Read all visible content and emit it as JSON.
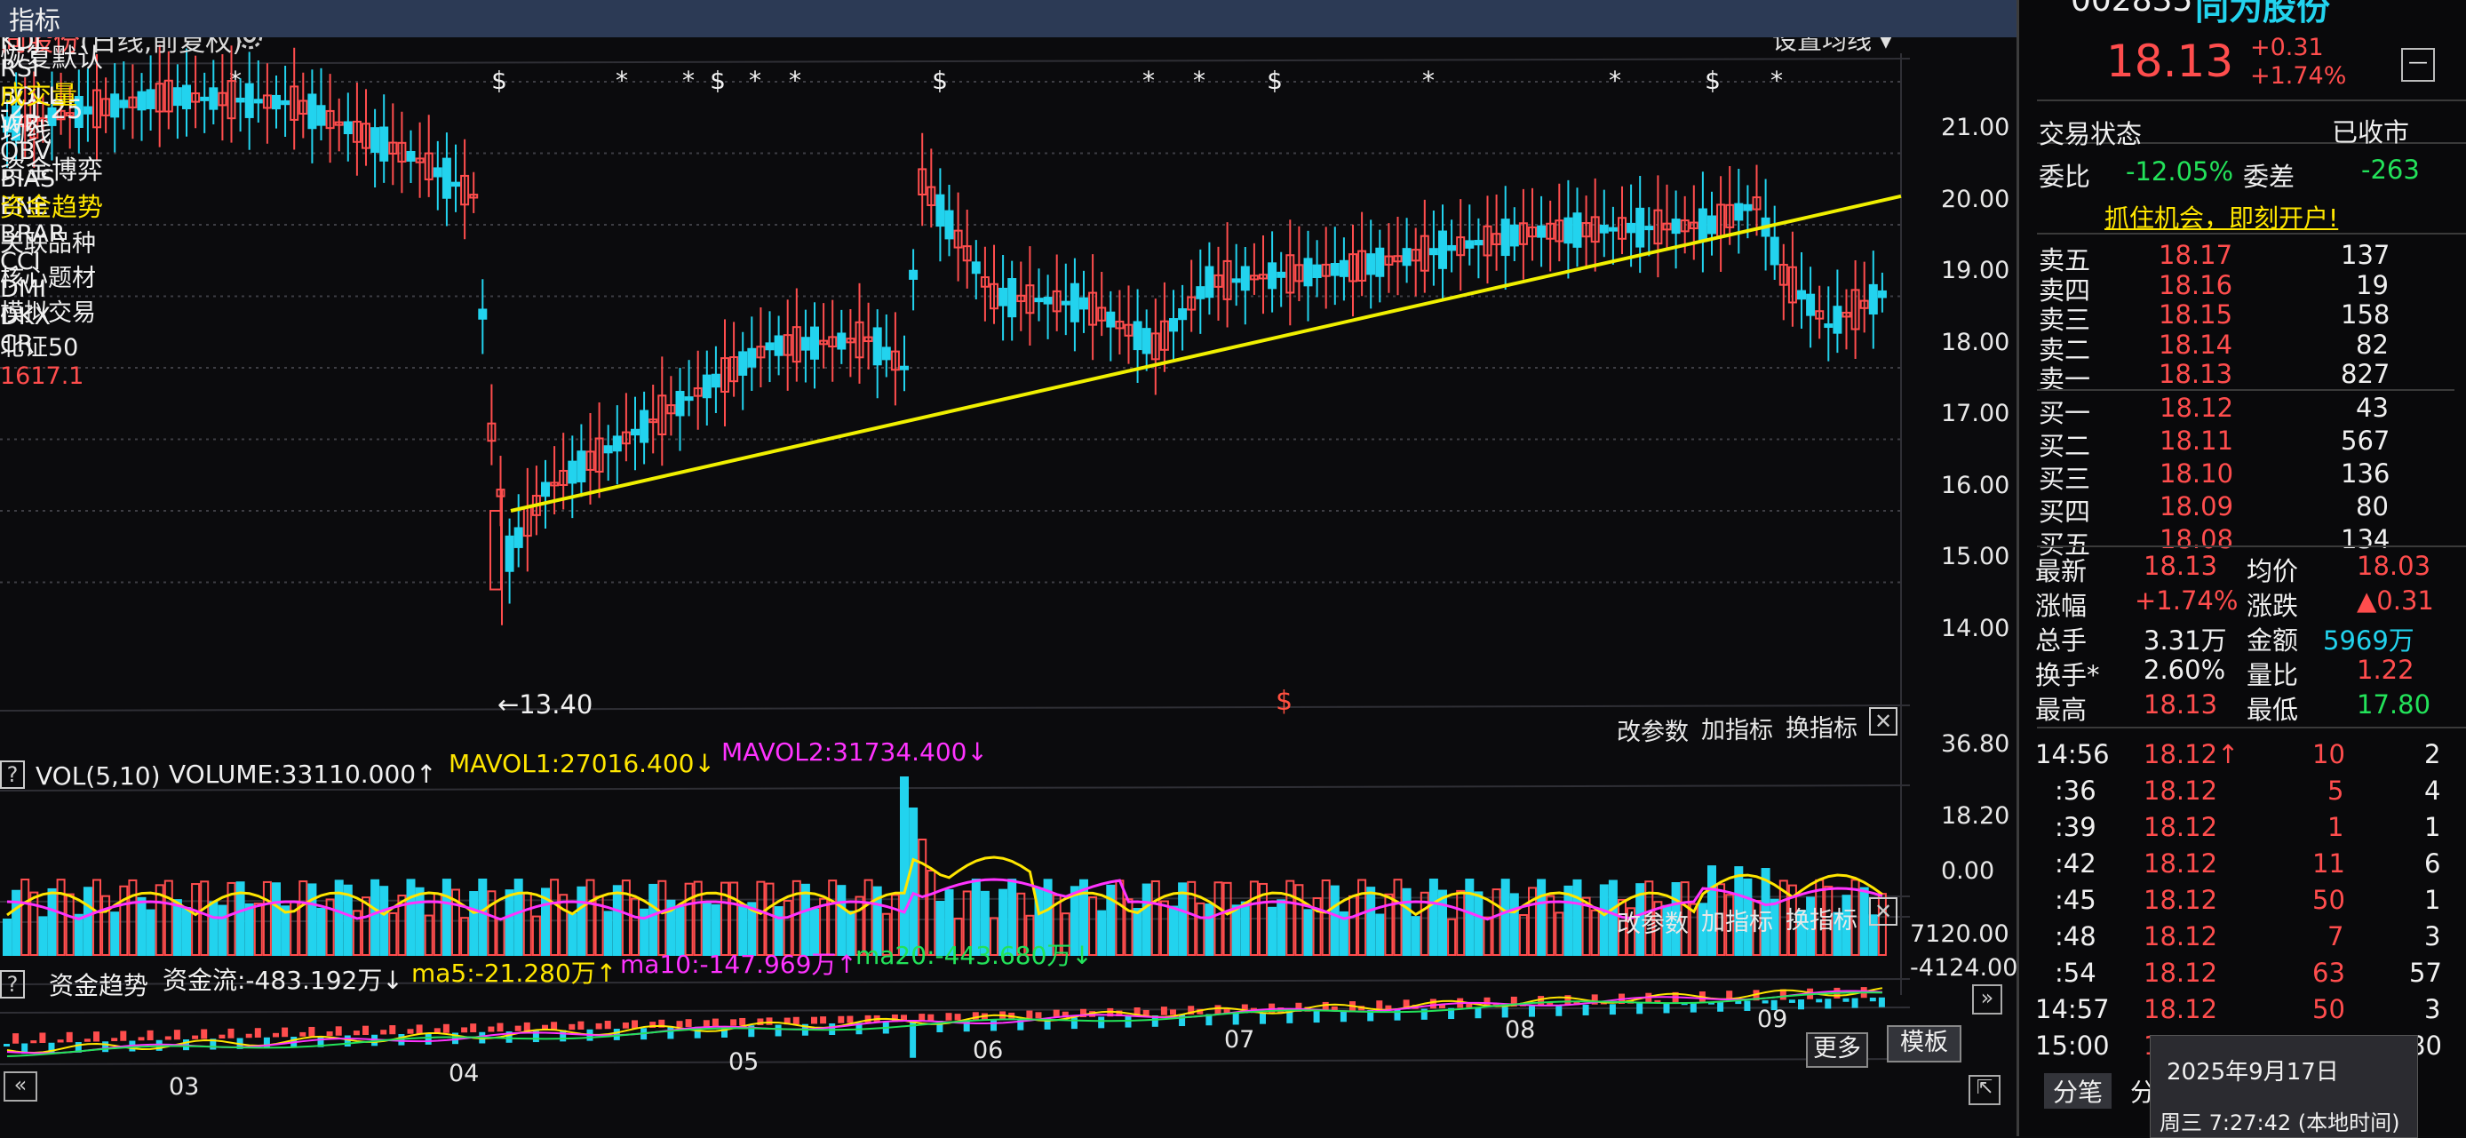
{
  "top_tabs": [
    {
      "label": "",
      "active": false
    },
    {
      "label": "",
      "active": false
    },
    {
      "label": "",
      "active": false
    },
    {
      "label": "",
      "active": false
    },
    {
      "label": "",
      "active": false
    },
    {
      "label": "",
      "active": true
    },
    {
      "label": "",
      "active": false
    },
    {
      "label": "",
      "active": false
    },
    {
      "label": "",
      "active": false
    }
  ],
  "chart": {
    "title_stock": "向股份",
    "title_mode": "(日线,前复权)",
    "set_ma_label": "设置均线 ▾",
    "price_axis": [
      "21.00",
      "20.00",
      "19.00",
      "18.00",
      "17.00",
      "16.00",
      "15.00",
      "14.00"
    ],
    "high_label": "-21.25",
    "low_label": "←13.40",
    "event_marker": "$",
    "param_btn": "改参数",
    "add_ind_btn": "加指标",
    "switch_ind_btn": "换指标",
    "close_btn": "✕"
  },
  "volume_panel": {
    "help": "?",
    "name": "VOL(5,10)",
    "volume": "VOLUME:33110.000↑",
    "mavol1": "MAVOL1:27016.400↓",
    "mavol2": "MAVOL2:31734.400↓",
    "axis": [
      "36.80",
      "18.20",
      "0.00"
    ]
  },
  "fund_panel": {
    "help": "?",
    "name": "资金趋势",
    "flow": "资金流:-483.192万↓",
    "ma5": "ma5:-21.280万↑",
    "ma10": "ma10:-147.969万↑",
    "ma20": "ma20:-443.680万↓",
    "axis": [
      "7120.00",
      "-4124.00"
    ]
  },
  "months": [
    "03",
    "04",
    "05",
    "06",
    "07",
    "08",
    "09"
  ],
  "indicator_tabs": [
    "MACD",
    "KDJ",
    "RSI",
    "BOLL",
    "WR",
    "OBV",
    "BIAS",
    "ENE",
    "BRAR",
    "CCI",
    "DMI",
    "DKX",
    "CR"
  ],
  "more_btn": "更多",
  "template_btn": "模板",
  "bottom_tabs": [
    "指标",
    "恢复默认",
    "成交量",
    "均线",
    "资金博弈",
    "资金趋势"
  ],
  "bottom_row2": [
    "关联品种",
    "核心题材",
    "模拟交易"
  ],
  "quote": {
    "code": "002835",
    "name": "同为股份",
    "price": "18.13",
    "change": "+0.31",
    "change_pct": "+1.74%",
    "status_label": "交易状态",
    "status_value": "已收市",
    "weibi_label": "委比",
    "weibi_value": "-12.05%",
    "weicha_label": "委差",
    "weicha_value": "-263",
    "banner": "抓住机会，即刻开户!",
    "asks": [
      {
        "label": "卖五",
        "price": "18.17",
        "vol": "137"
      },
      {
        "label": "卖四",
        "price": "18.16",
        "vol": "19"
      },
      {
        "label": "卖三",
        "price": "18.15",
        "vol": "158"
      },
      {
        "label": "卖二",
        "price": "18.14",
        "vol": "82"
      },
      {
        "label": "卖一",
        "price": "18.13",
        "vol": "827"
      }
    ],
    "bids": [
      {
        "label": "买一",
        "price": "18.12",
        "vol": "43"
      },
      {
        "label": "买二",
        "price": "18.11",
        "vol": "567"
      },
      {
        "label": "买三",
        "price": "18.10",
        "vol": "136"
      },
      {
        "label": "买四",
        "price": "18.09",
        "vol": "80"
      },
      {
        "label": "买五",
        "price": "18.08",
        "vol": "134"
      }
    ],
    "stats": [
      {
        "l1": "最新",
        "v1": "18.13",
        "l2": "均价",
        "v2": "18.03"
      },
      {
        "l1": "涨幅",
        "v1": "+1.74%",
        "l2": "涨跌",
        "v2": "▲0.31"
      },
      {
        "l1": "总手",
        "v1": "3.31万",
        "l2": "金额",
        "v2": "5969万"
      },
      {
        "l1": "换手*",
        "v1": "2.60%",
        "l2": "量比",
        "v2": "1.22"
      },
      {
        "l1": "最高",
        "v1": "18.13",
        "l2": "最低",
        "v2": "17.80"
      }
    ],
    "ticks": [
      {
        "time": "14:56",
        "price": "18.12↑",
        "vol": "10",
        "n": "2"
      },
      {
        "time": ":36",
        "price": "18.12",
        "vol": "5",
        "n": "4"
      },
      {
        "time": ":39",
        "price": "18.12",
        "vol": "1",
        "n": "1"
      },
      {
        "time": ":42",
        "price": "18.12",
        "vol": "11",
        "n": "6"
      },
      {
        "time": ":45",
        "price": "18.12",
        "vol": "50",
        "n": "1"
      },
      {
        "time": ":48",
        "price": "18.12",
        "vol": "7",
        "n": "3"
      },
      {
        "time": ":54",
        "price": "18.12",
        "vol": "63",
        "n": "57"
      },
      {
        "time": "14:57",
        "price": "18.12",
        "vol": "50",
        "n": "3"
      },
      {
        "time": "15:00",
        "price": "18.13↑",
        "vol": "751",
        "n": "80"
      }
    ],
    "tab_a": "分笔",
    "tab_b": "分"
  },
  "status_bar": {
    "index_name": "北证50",
    "index_value": "1617.1",
    "date": "2025年9月17日",
    "time": "周三 7:27:42 (本地时间)"
  },
  "colors": {
    "up": "#ff4d4d",
    "down": "#22d3ee",
    "ma_yellow": "#ffe600",
    "ma_magenta": "#ff33ff",
    "trend_line": "#f0f000"
  }
}
